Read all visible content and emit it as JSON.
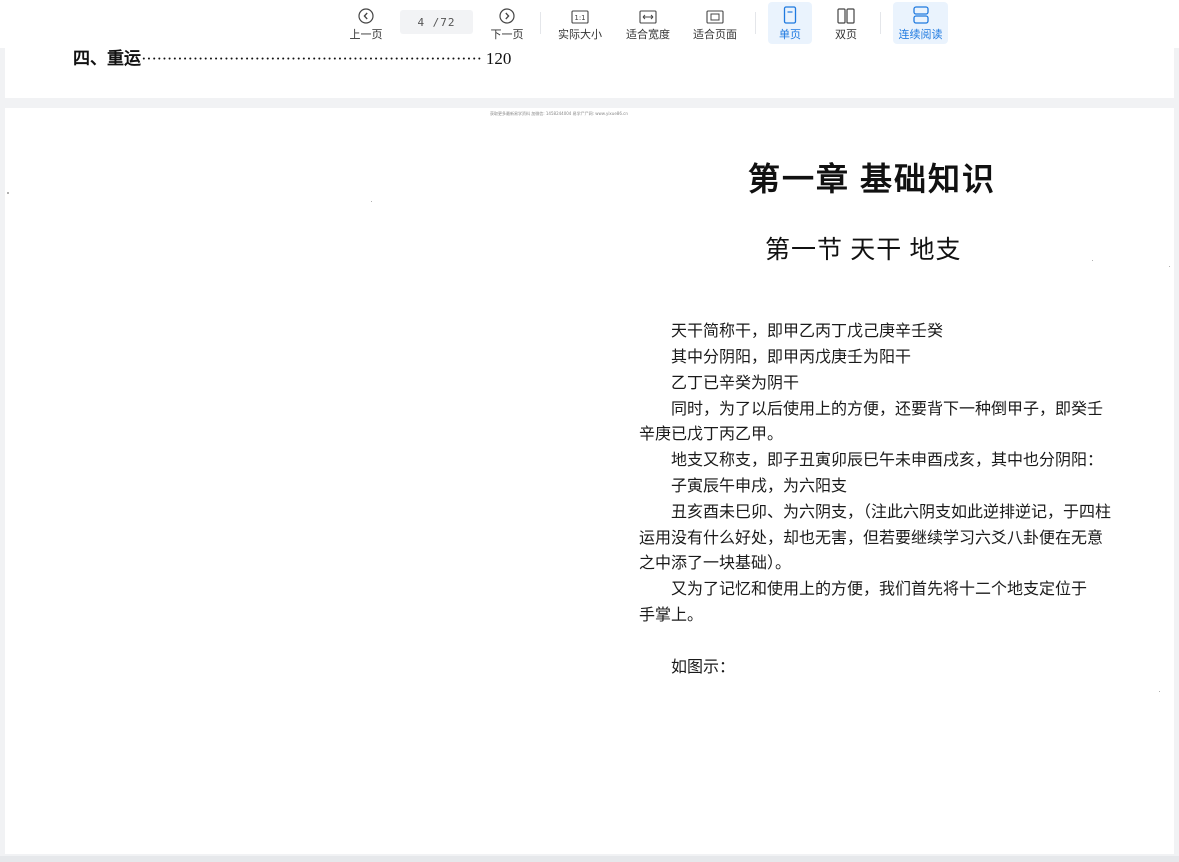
{
  "toolbar": {
    "prev_page": "上一页",
    "page_indicator": "4 /72",
    "next_page": "下一页",
    "actual_size": "实际大小",
    "actual_size_icon_text": "1:1",
    "fit_width": "适合宽度",
    "fit_page": "适合页面",
    "single_page": "单页",
    "double_page": "双页",
    "continuous_reading": "连续阅读"
  },
  "previous_page": {
    "toc_entry": "四、重运",
    "toc_leader": "··································································",
    "toc_page": "120"
  },
  "current_page": {
    "watermark": "获取更多最新易学资料 加微信: 1458244004 易学尸尸网: www.yixue86.cn",
    "chapter_title": "第一章  基础知识",
    "section_title": "第一节  天干  地支",
    "lines": [
      "天干简称干，即甲乙丙丁戊己庚辛壬癸",
      "其中分阴阳，即甲丙戊庚壬为阳干",
      "乙丁已辛癸为阴干",
      "同时，为了以后使用上的方便，还要背下一种倒甲子，即癸壬",
      "辛庚已戊丁丙乙甲。",
      "地支又称支，即子丑寅卯辰巳午未申酉戌亥，其中也分阴阳：",
      "子寅辰午申戌，为六阳支",
      "丑亥酉未巳卯、为六阴支，（注此六阴支如此逆排逆记，于四柱",
      "运用没有什么好处，却也无害，但若要继续学习六爻八卦便在无意",
      "之中添了一块基础）。",
      "又为了记忆和使用上的方便，我们首先将十二个地支定位于",
      "手掌上。",
      "如图示："
    ]
  },
  "colors": {
    "accent": "#1f7ae0",
    "active_bg": "#eaf3fd",
    "viewer_bg": "#f1f2f4"
  },
  "icons": {
    "prev": "circle-chevron-left-icon",
    "next": "circle-chevron-right-icon",
    "actual_size": "one-to-one-icon",
    "fit_width": "fit-width-icon",
    "fit_page": "fit-page-icon",
    "single_page": "single-page-icon",
    "double_page": "double-page-icon",
    "continuous": "continuous-scroll-icon"
  }
}
